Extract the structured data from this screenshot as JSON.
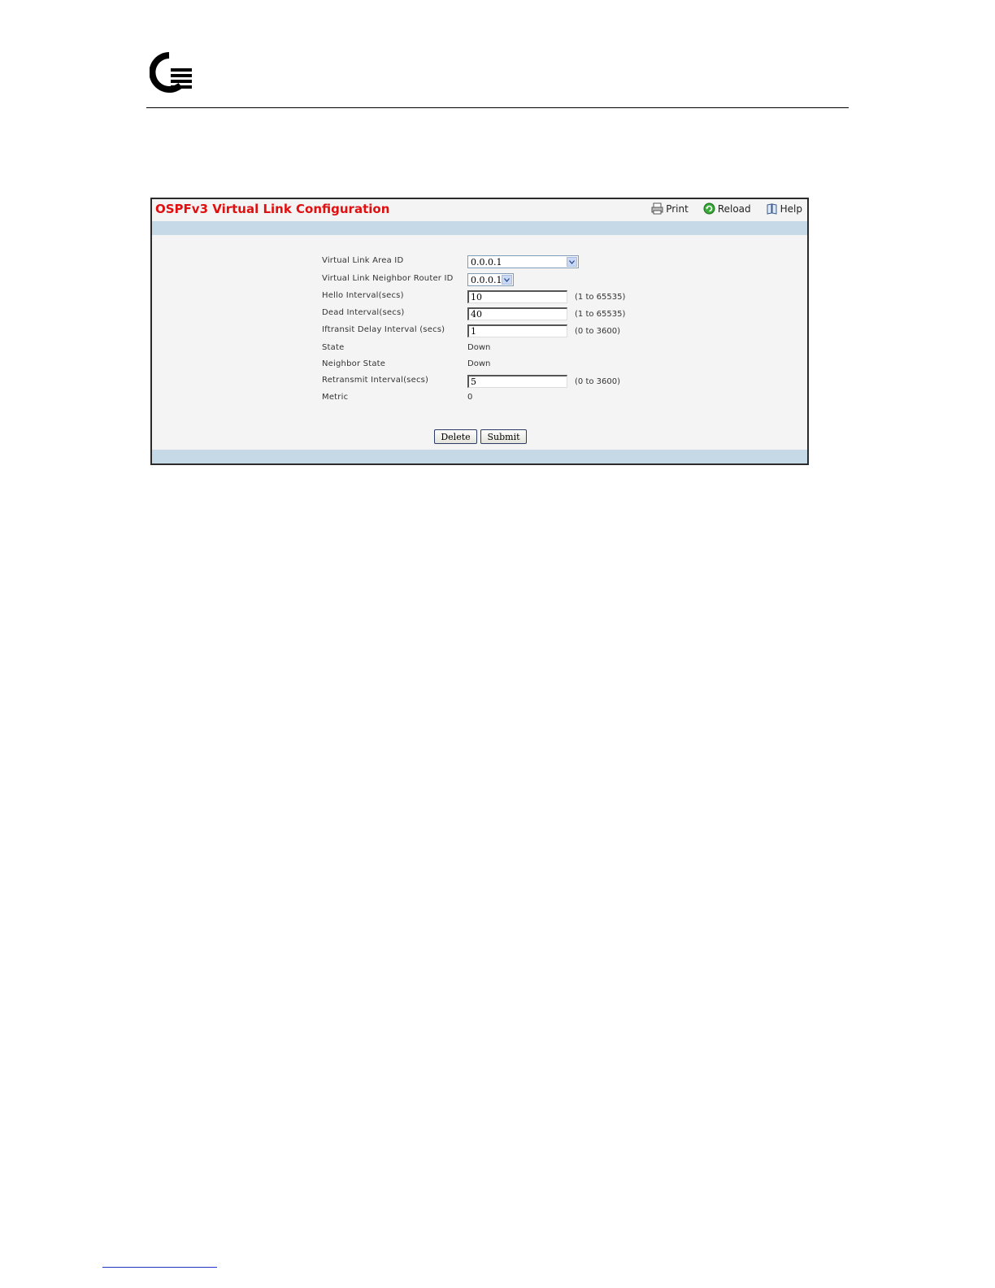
{
  "page": {
    "title": "OSPFv3 Virtual Link Configuration",
    "toolbar": {
      "print": "Print",
      "reload": "Reload",
      "help": "Help"
    }
  },
  "form": {
    "area_id": {
      "label": "Virtual Link Area ID",
      "value": "0.0.0.1"
    },
    "neighbor_router_id": {
      "label": "Virtual Link Neighbor Router ID",
      "value": "0.0.0.1"
    },
    "hello_interval": {
      "label": "Hello Interval(secs)",
      "value": "10",
      "range": "(1 to 65535)"
    },
    "dead_interval": {
      "label": "Dead Interval(secs)",
      "value": "40",
      "range": "(1 to 65535)"
    },
    "transit_delay": {
      "label": "Iftransit Delay Interval (secs)",
      "value": "1",
      "range": "(0 to 3600)"
    },
    "state": {
      "label": "State",
      "value": "Down"
    },
    "neighbor_state": {
      "label": "Neighbor State",
      "value": "Down"
    },
    "retransmit_interval": {
      "label": "Retransmit Interval(secs)",
      "value": "5",
      "range": "(0 to 3600)"
    },
    "metric": {
      "label": "Metric",
      "value": "0"
    }
  },
  "buttons": {
    "delete": "Delete",
    "submit": "Submit"
  },
  "colors": {
    "title": "#e01010",
    "band": "#c5d9e6",
    "panel_bg": "#f4f4f4"
  },
  "icons": [
    "company-logo",
    "print-icon",
    "reload-icon",
    "help-icon",
    "dropdown-arrow-icon"
  ]
}
